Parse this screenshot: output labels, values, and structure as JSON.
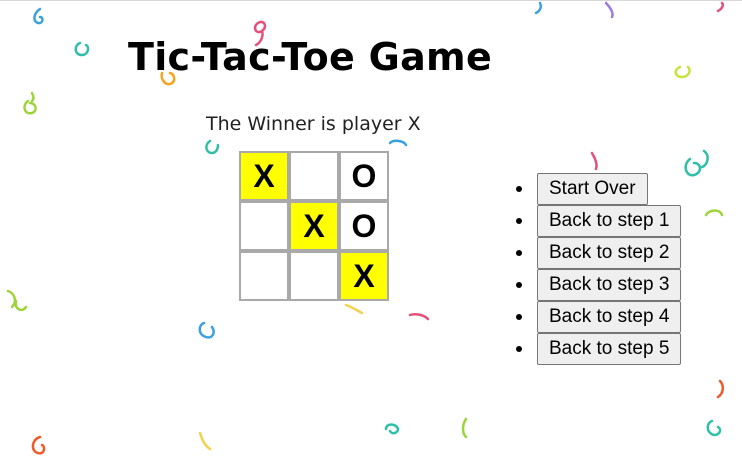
{
  "title": "Tic-Tac-Toe Game",
  "status": "The Winner is player X",
  "board": {
    "squares": [
      "X",
      "",
      "O",
      "",
      "X",
      "O",
      "",
      "",
      "X"
    ],
    "winning_squares": [
      0,
      4,
      8
    ],
    "highlight_color": "#ffff00"
  },
  "moves": [
    "Start Over",
    "Back to step 1",
    "Back to step 2",
    "Back to step 3",
    "Back to step 4",
    "Back to step 5"
  ]
}
